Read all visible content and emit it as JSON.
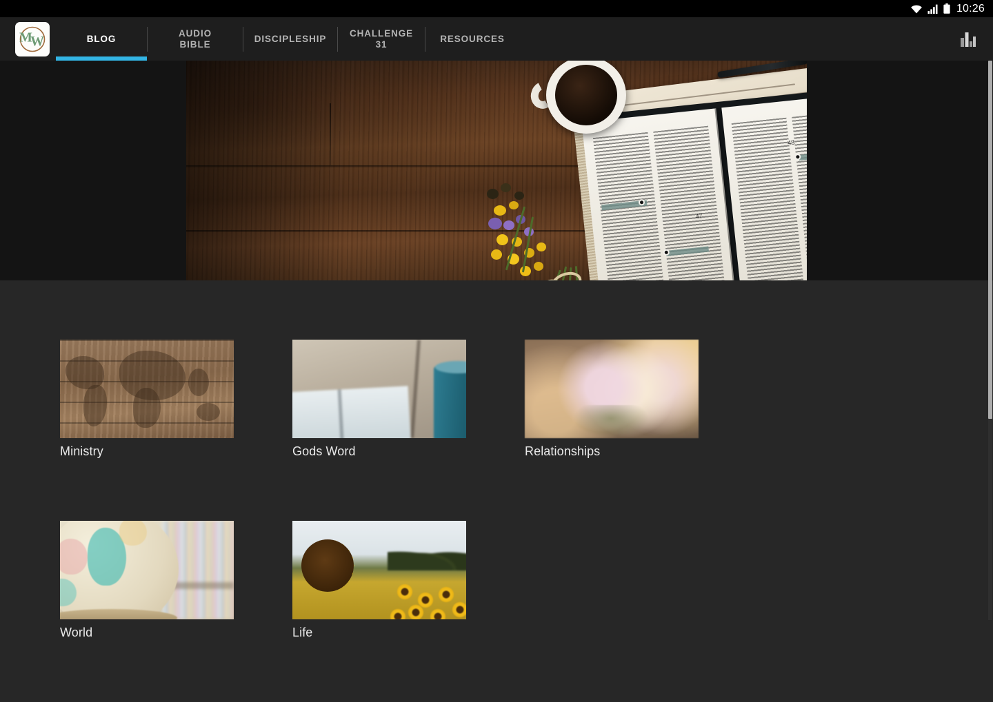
{
  "status_bar": {
    "time": "10:26",
    "icons": [
      "wifi-icon",
      "cellular-signal-icon",
      "battery-icon"
    ]
  },
  "app_bar": {
    "logo": {
      "name": "app-logo",
      "initials": "MW",
      "ring_color": "#a06b3c",
      "text_color": "#6f9c76",
      "background": "#fdfdfb"
    },
    "active_indicator_color": "#33b5e5",
    "background": "#1e1e1e",
    "tabs": [
      {
        "label": "BLOG",
        "key": "blog",
        "active": true
      },
      {
        "label": "AUDIO\nBIBLE",
        "key": "audio-bible",
        "active": false
      },
      {
        "label": "DISCIPLESHIP",
        "key": "discipleship",
        "active": false
      },
      {
        "label": "CHALLENGE\n31",
        "key": "challenge-31",
        "active": false
      },
      {
        "label": "RESOURCES",
        "key": "resources",
        "active": false
      }
    ],
    "actions": [
      {
        "name": "stats-icon",
        "label": "Stats"
      }
    ]
  },
  "hero": {
    "name": "hero-banner",
    "description": "Open Bible on a dark wooden table with a white mug of black coffee, a journal with handwriting, a pen, and a bouquet of yellow and purple wildflowers tied with twine",
    "bible_page_numbers": [
      "47",
      "48"
    ],
    "band_background": "#141414"
  },
  "content": {
    "background": "#272727",
    "categories": [
      {
        "label": "Ministry",
        "key": "ministry",
        "image": "world-map-on-wood-planks"
      },
      {
        "label": "Gods Word",
        "key": "gods-word",
        "image": "open-book-with-teal-mug"
      },
      {
        "label": "Relationships",
        "key": "relationships",
        "image": "table-setting-with-flowers"
      },
      {
        "label": "World",
        "key": "world",
        "image": "vintage-globe-by-bookshelf"
      },
      {
        "label": "Life",
        "key": "life",
        "image": "sunflower-field"
      }
    ]
  },
  "scrollbar": {
    "name": "vertical-scrollbar",
    "color": "#adadad"
  }
}
